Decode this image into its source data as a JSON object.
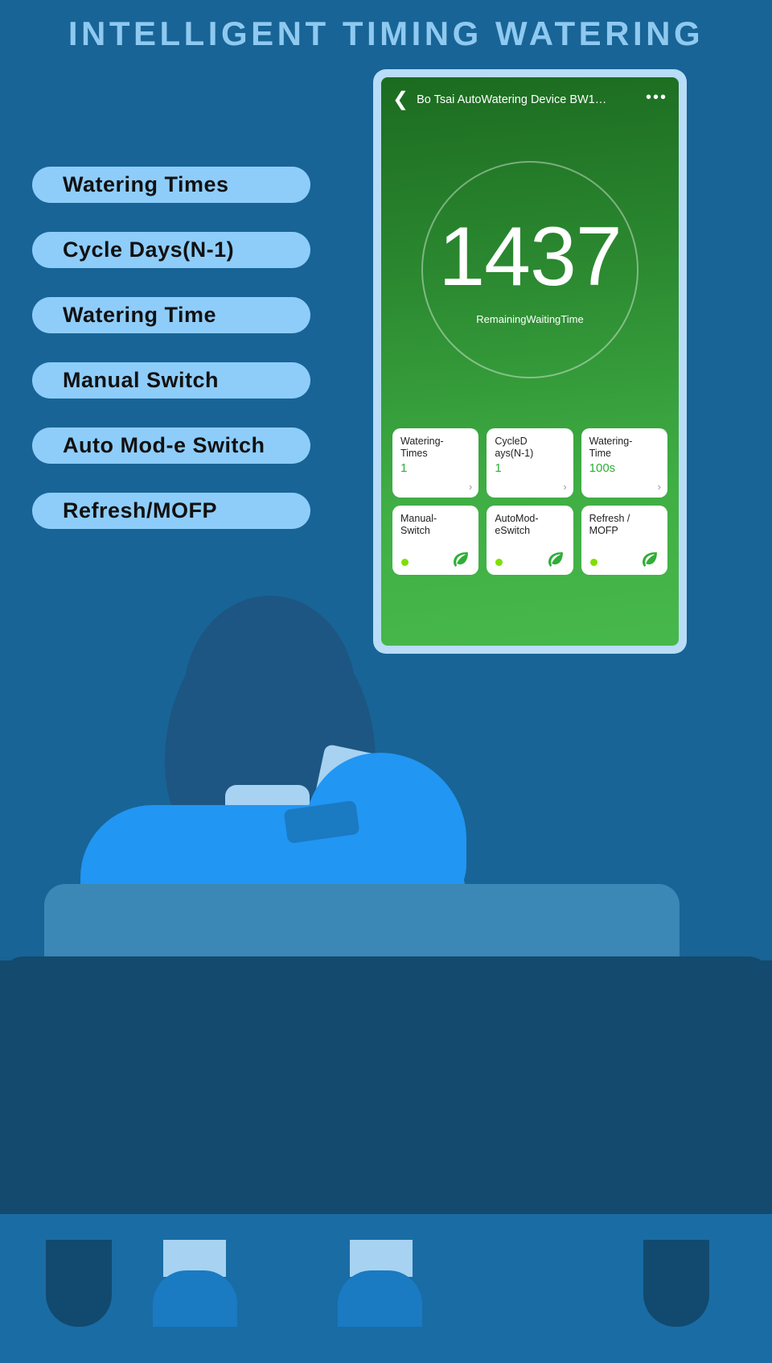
{
  "page": {
    "title": "INTELLIGENT TIMING WATERING",
    "title_color": "#8fc9f0",
    "background_color": "#186496"
  },
  "feature_list": {
    "items": [
      {
        "label": "Watering Times"
      },
      {
        "label": "Cycle Days(N-1)"
      },
      {
        "label": "Watering Time"
      },
      {
        "label": "Manual Switch"
      },
      {
        "label": "Auto Mod-e Switch"
      },
      {
        "label": "Refresh/MOFP"
      }
    ]
  },
  "phone": {
    "bezel_color": "#b9dcf7",
    "app": {
      "header": {
        "back_icon": "chevron-left-icon",
        "title": "Bo Tsai AutoWatering Device  BW1…",
        "menu_icon": "more-options-icon",
        "menu_label": "•••"
      },
      "gauge": {
        "value": "1437",
        "label": "RemainingWaitingTime"
      },
      "cards": [
        {
          "name": "Watering-\nTimes",
          "name_line1": "Watering-",
          "name_line2": "Times",
          "value": "1",
          "chevron": "›",
          "has_chevron": true,
          "has_toggle": false
        },
        {
          "name_line1": "CycleD",
          "name_line2": "ays(N-1)",
          "value": "1",
          "chevron": "›",
          "has_chevron": true,
          "has_toggle": false
        },
        {
          "name_line1": "Watering-",
          "name_line2": "Time",
          "value": "100s",
          "chevron": "›",
          "has_chevron": true,
          "has_toggle": false
        },
        {
          "name_line1": "Manual-",
          "name_line2": "Switch",
          "value": "",
          "has_chevron": false,
          "has_toggle": true,
          "status_color": "#7ee000",
          "icon": "leaf-icon"
        },
        {
          "name_line1": "AutoMod-",
          "name_line2": "eSwitch",
          "value": "",
          "has_chevron": false,
          "has_toggle": true,
          "status_color": "#7ee000",
          "icon": "leaf-icon"
        },
        {
          "name_line1": "Refresh /",
          "name_line2": "MOFP",
          "value": "",
          "has_chevron": false,
          "has_toggle": true,
          "status_color": "#7ee000",
          "icon": "leaf-icon"
        }
      ]
    }
  },
  "illustration": {
    "description": "person-on-sofa-back-view",
    "hair_color": "#1d5682",
    "shirt_color": "#2196f3",
    "collar_color": "#a7d2f1",
    "sofa_color": "#134a6d"
  }
}
